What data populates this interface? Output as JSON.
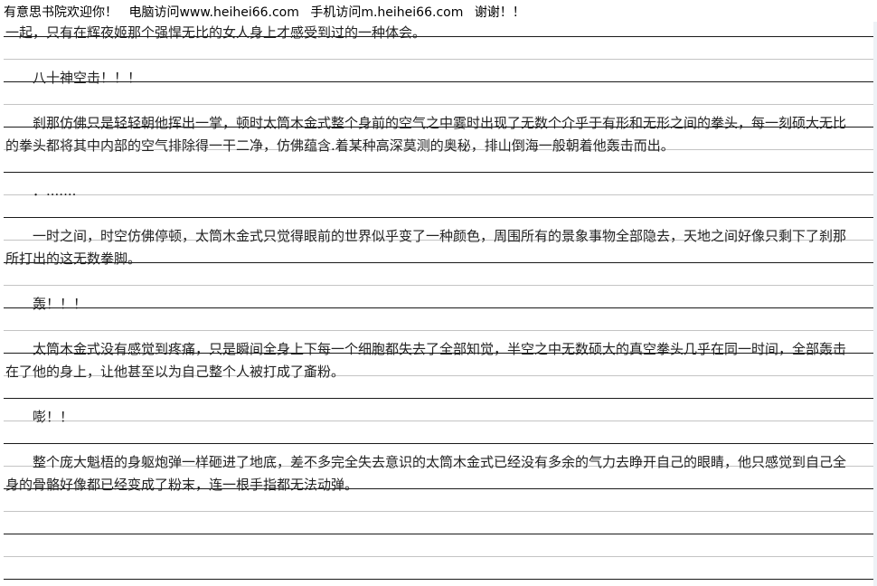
{
  "header": {
    "site_name": "有意思书院欢迎你！",
    "pc_visit": "电脑访问www.heihei66.com",
    "mobile_visit": "手机访问m.heihei66.com",
    "thanks": "谢谢！！"
  },
  "paragraphs": [
    "一起，只有在辉夜姬那个强悍无比的女人身上才感受到过的一种体会。",
    "八十神空击！！！",
    "刹那仿佛只是轻轻朝他挥出一掌，顿时太筒木金式整个身前的空气之中霎时出现了无数个介乎于有形和无形之间的拳头，每一刻硕大无比的拳头都将其中内部的空气排除得一干二净，仿佛蕴含.着某种高深莫测的奥秘，排山倒海一般朝着他轰击而出。",
    "．.......",
    "一时之间，时空仿佛停顿，太筒木金式只觉得眼前的世界似乎变了一种颜色，周围所有的景象事物全部隐去，天地之间好像只剩下了刹那所打出的这无数拳脚。",
    "轰！！！",
    "太筒木金式没有感觉到疼痛，只是瞬间全身上下每一个细胞都失去了全部知觉，半空之中无数硕大的真空拳头几乎在同一时间，全部轰击在了他的身上，让他甚至以为自己整个人被打成了齑粉。",
    "嘭！！",
    "整个庞大魁梧的身躯炮弹一样砸进了地底，差不多完全失去意识的太筒木金式已经没有多余的气力去睁开自己的眼睛，他只感觉到自己全身的骨骼好像都已经变成了粉末，连一根手指都无法动弹。"
  ]
}
